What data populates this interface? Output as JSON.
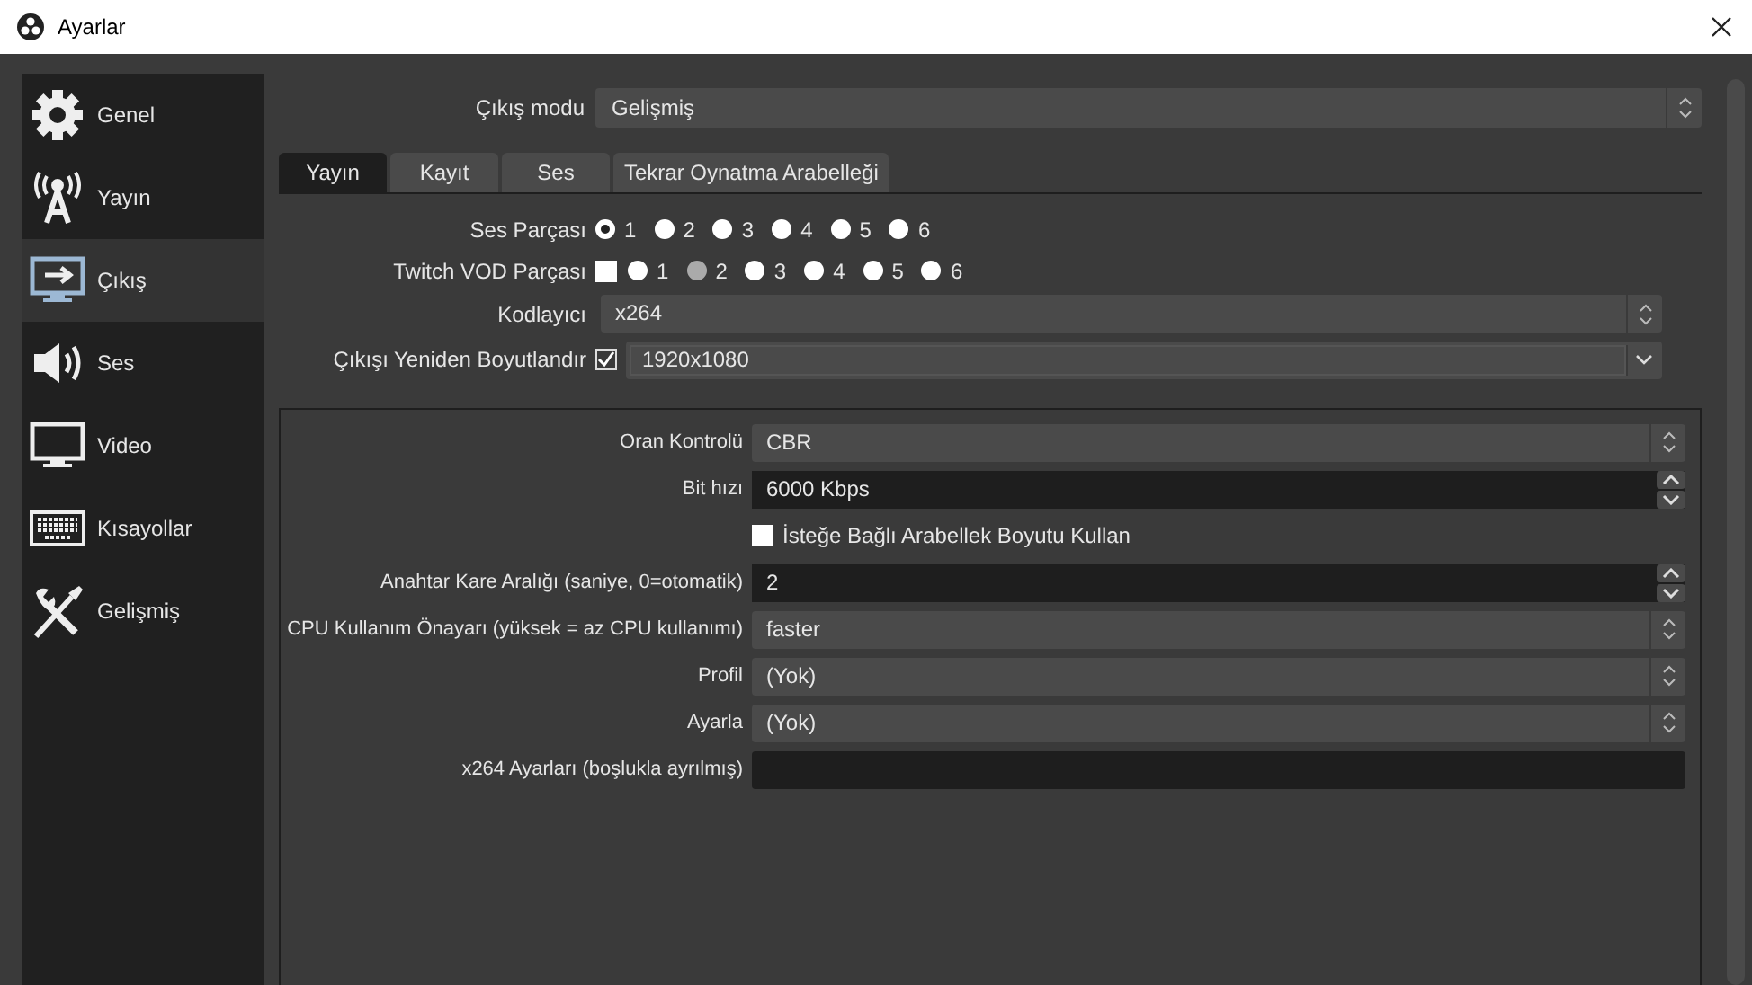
{
  "window": {
    "title": "Ayarlar"
  },
  "sidebar": {
    "items": [
      {
        "label": "Genel",
        "selected": false
      },
      {
        "label": "Yayın",
        "selected": false
      },
      {
        "label": "Çıkış",
        "selected": true
      },
      {
        "label": "Ses",
        "selected": false
      },
      {
        "label": "Video",
        "selected": false
      },
      {
        "label": "Kısayollar",
        "selected": false
      },
      {
        "label": "Gelişmiş",
        "selected": false
      }
    ]
  },
  "output_mode": {
    "label": "Çıkış modu",
    "value": "Gelişmiş"
  },
  "tabs": [
    {
      "label": "Yayın",
      "selected": true
    },
    {
      "label": "Kayıt",
      "selected": false
    },
    {
      "label": "Ses",
      "selected": false
    },
    {
      "label": "Tekrar Oynatma Arabelleği",
      "selected": false
    }
  ],
  "audio_track": {
    "label": "Ses Parçası",
    "options": [
      {
        "label": "1",
        "selected": true
      },
      {
        "label": "2",
        "selected": false
      },
      {
        "label": "3",
        "selected": false
      },
      {
        "label": "4",
        "selected": false
      },
      {
        "label": "5",
        "selected": false
      },
      {
        "label": "6",
        "selected": false
      }
    ]
  },
  "twitch_vod": {
    "label": "Twitch VOD Parçası",
    "checked": false,
    "options": [
      {
        "label": "1",
        "selected": false,
        "disabled": false
      },
      {
        "label": "2",
        "selected": false,
        "disabled": true
      },
      {
        "label": "3",
        "selected": false,
        "disabled": false
      },
      {
        "label": "4",
        "selected": false,
        "disabled": false
      },
      {
        "label": "5",
        "selected": false,
        "disabled": false
      },
      {
        "label": "6",
        "selected": false,
        "disabled": false
      }
    ]
  },
  "encoder": {
    "label": "Kodlayıcı",
    "value": "x264"
  },
  "rescale": {
    "label": "Çıkışı Yeniden Boyutlandır",
    "checked": true,
    "value": "1920x1080"
  },
  "encoder_settings": [
    {
      "kind": "select",
      "label": "Oran Kontrolü",
      "value": "CBR"
    },
    {
      "kind": "spin",
      "label": "Bit hızı",
      "value": "6000 Kbps"
    },
    {
      "kind": "checkbox",
      "label": "İsteğe Bağlı Arabellek Boyutu Kullan",
      "checked": false
    },
    {
      "kind": "spin",
      "label": "Anahtar Kare Aralığı (saniye, 0=otomatik)",
      "value": "2"
    },
    {
      "kind": "select",
      "label": "CPU Kullanım Önayarı (yüksek = az CPU kullanımı)",
      "value": "faster"
    },
    {
      "kind": "select",
      "label": "Profil",
      "value": "(Yok)"
    },
    {
      "kind": "select",
      "label": "Ayarla",
      "value": "(Yok)"
    },
    {
      "kind": "text",
      "label": "x264 Ayarları (boşlukla ayrılmış)"
    }
  ]
}
